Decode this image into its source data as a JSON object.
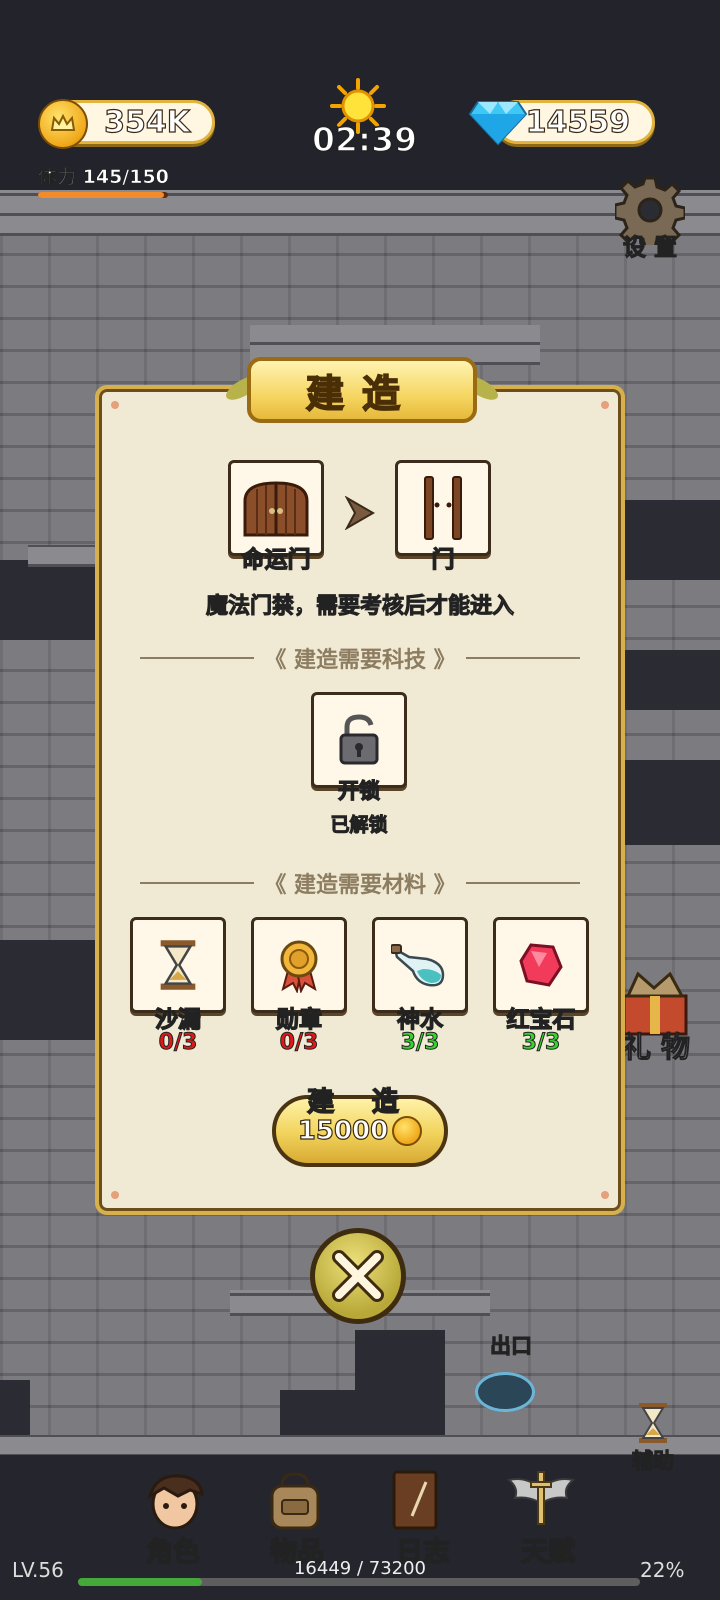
{
  "hud": {
    "gold": "354K",
    "time": "02:39",
    "gems": "14559",
    "stamina_label": "体力",
    "stamina_value": "145/150",
    "stamina_fraction": 0.967,
    "settings_label": "设 置",
    "gift_label": "礼 物",
    "exit_label": "出口",
    "assist_label": "辅助"
  },
  "modal": {
    "title": "建造",
    "from_item": "命运门",
    "to_item": "门",
    "description": "魔法门禁，需要考核后才能进入",
    "tech_header": "建造需要科技",
    "tech": {
      "name": "开锁",
      "status": "已解锁"
    },
    "materials_header": "建造需要材料",
    "materials": [
      {
        "name": "沙漏",
        "count": "0/3"
      },
      {
        "name": "勋章",
        "count": "0/3"
      },
      {
        "name": "神水",
        "count": "3/3"
      },
      {
        "name": "红宝石",
        "count": "3/3"
      }
    ],
    "build_label": "建 造",
    "build_cost": "15000"
  },
  "nav": {
    "items": [
      "角色",
      "物品",
      "日志",
      "天赋"
    ]
  },
  "level": {
    "label": "LV.56",
    "xp": "16449 / 73200",
    "percent": "22%",
    "fraction": 0.22
  },
  "colors": {
    "red_count": "#e01818",
    "green_count": "#36d42e",
    "unlocked": "#3fe12e",
    "gold_border": "#e3b43d"
  }
}
